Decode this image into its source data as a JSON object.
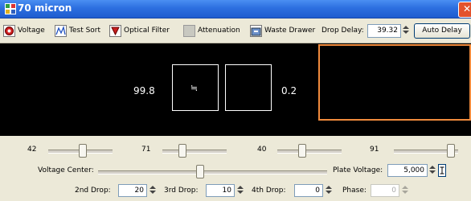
{
  "window": {
    "title": "70 micron",
    "close_glyph": "✕",
    "accent": "#2d6fe0"
  },
  "toolbar": {
    "voltage": "Voltage",
    "test_sort": "Test Sort",
    "optical_filter": "Optical Filter",
    "attenuation": "Attenuation",
    "waste_drawer": "Waste Drawer",
    "drop_delay_label": "Drop Delay:",
    "drop_delay_value": "39.32",
    "auto_delay": "Auto Delay"
  },
  "display": {
    "left_percent": "99.8",
    "center_symbol": "≒",
    "right_percent": "0.2"
  },
  "sliders": {
    "values": [
      "42",
      "71",
      "40",
      "91"
    ],
    "voltage_center_label": "Voltage Center:",
    "plate_voltage_label": "Plate Voltage:",
    "plate_voltage_value": "5,000"
  },
  "drops": {
    "second_label": "2nd Drop:",
    "second_value": "20",
    "third_label": "3rd Drop:",
    "third_value": "10",
    "fourth_label": "4th Drop:",
    "fourth_value": "0",
    "phase_label": "Phase:",
    "phase_value": "0"
  },
  "highlight_color": "#f08a3c"
}
